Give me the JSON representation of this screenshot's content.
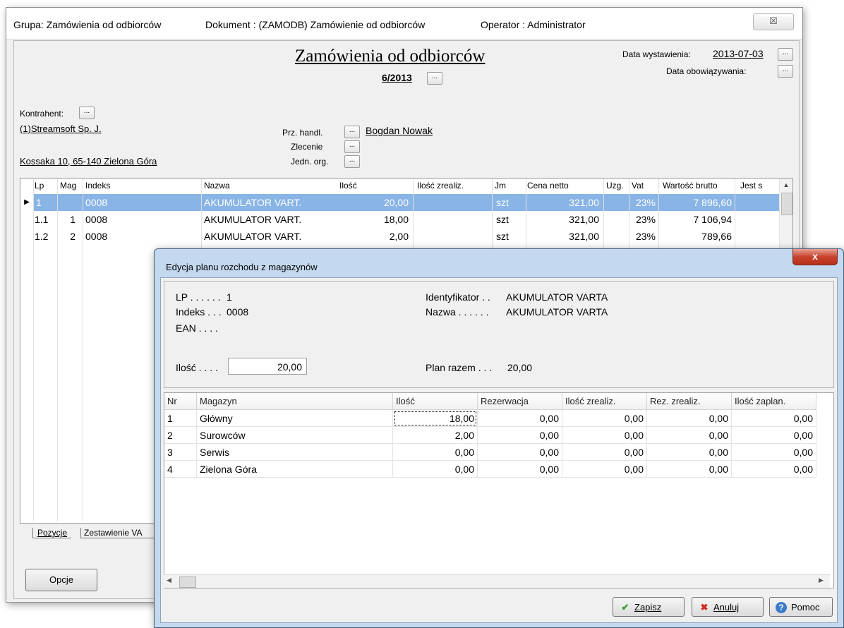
{
  "main_window": {
    "title_group": "Grupa: Zamówienia od odbiorców",
    "title_document": "Dokument : (ZAMODB) Zamówienie od odbiorców",
    "title_operator": "Operator : Administrator",
    "close_glyph": "☒"
  },
  "document": {
    "heading": "Zamówienia od odbiorców",
    "number": "6/2013",
    "issue_date_label": "Data wystawienia:",
    "issue_date_value": "2013-07-03",
    "valid_date_label": "Data obowiązywania:",
    "dots": "..."
  },
  "contractor": {
    "label": "Kontrahent:",
    "name": "(1)Streamsoft Sp. J.",
    "address": "Kossaka 10, 65-140 Zielona Góra"
  },
  "fields": {
    "salesperson_label": "Prz. handl.",
    "salesperson_value": "Bogdan Nowak",
    "order_label": "Zlecenie",
    "org_unit_label": "Jedn. org."
  },
  "positions_grid": {
    "headers": [
      "Lp",
      "Mag",
      "Indeks",
      "Nazwa",
      "Ilość",
      "Ilość zrealiz.",
      "Jm",
      "Cena netto",
      "Uzg.",
      "Vat",
      "Wartość brutto",
      "Jest s"
    ],
    "rows": [
      {
        "lp": "1",
        "mag": "",
        "indeks": "0008",
        "nazwa": "AKUMULATOR VART.",
        "ilosc": "20,00",
        "zreal": "",
        "jm": "szt",
        "cena": "321,00",
        "uzg": "",
        "vat": "23%",
        "brutto": "7 896,60",
        "selected": true
      },
      {
        "lp": "1.1",
        "mag": "1",
        "indeks": "0008",
        "nazwa": "AKUMULATOR VART.",
        "ilosc": "18,00",
        "zreal": "",
        "jm": "szt",
        "cena": "321,00",
        "uzg": "",
        "vat": "23%",
        "brutto": "7 106,94",
        "selected": false
      },
      {
        "lp": "1.2",
        "mag": "2",
        "indeks": "0008",
        "nazwa": "AKUMULATOR VART.",
        "ilosc": "2,00",
        "zreal": "",
        "jm": "szt",
        "cena": "321,00",
        "uzg": "",
        "vat": "23%",
        "brutto": "789,66",
        "selected": false
      }
    ],
    "row_marker": "▶"
  },
  "tabs": [
    "Pozycje",
    "Zestawienie VA"
  ],
  "options_button": "Opcje",
  "dialog": {
    "title": "Edycja planu rozchodu z magazynów",
    "close_glyph": "x",
    "lp_label": "LP . . . . . .",
    "lp_value": "1",
    "index_label": "Indeks . . .",
    "index_value": "0008",
    "ean_label": "EAN . . . .",
    "identifier_label": "Identyfikator . .",
    "identifier_value": "AKUMULATOR VARTA",
    "name_label": "Nazwa . . . . . .",
    "name_value": "AKUMULATOR VARTA",
    "qty_label": "Ilość . . . .",
    "qty_value": "20,00",
    "plan_label": "Plan razem . . .",
    "plan_value": "20,00",
    "grid_headers": [
      "Nr",
      "Magazyn",
      "Ilość",
      "Rezerwacja",
      "Ilość zrealiz.",
      "Rez. zrealiz.",
      "Ilość zaplan."
    ],
    "grid_rows": [
      [
        "1",
        "Główny",
        "18,00",
        "0,00",
        "0,00",
        "0,00",
        "0,00"
      ],
      [
        "2",
        "Surowców",
        "2,00",
        "0,00",
        "0,00",
        "0,00",
        "0,00"
      ],
      [
        "3",
        "Serwis",
        "0,00",
        "0,00",
        "0,00",
        "0,00",
        "0,00"
      ],
      [
        "4",
        "Zielona Góra",
        "0,00",
        "0,00",
        "0,00",
        "0,00",
        "0,00"
      ]
    ],
    "buttons": {
      "save": "Zapisz",
      "cancel": "Anuluj",
      "help": "Pomoc"
    },
    "save_icon": "✔",
    "cancel_icon": "✖",
    "help_icon": "?"
  }
}
